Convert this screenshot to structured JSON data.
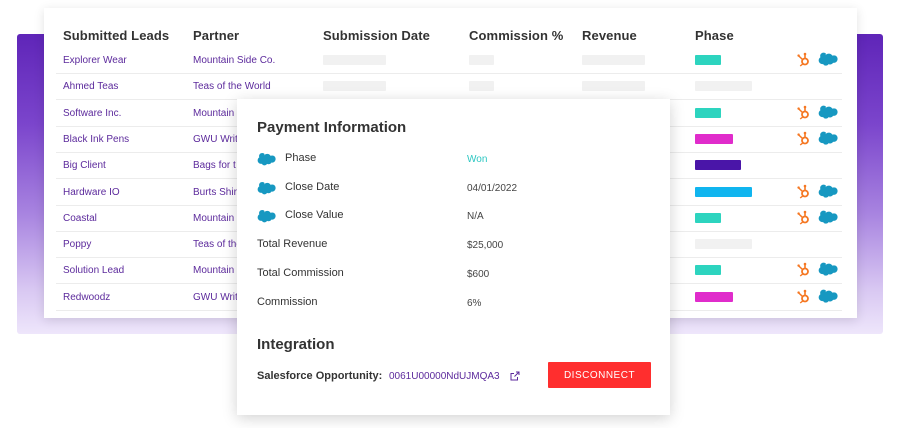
{
  "table": {
    "headers": {
      "lead": "Submitted Leads",
      "partner": "Partner",
      "submission_date": "Submission Date",
      "commission": "Commission %",
      "revenue": "Revenue",
      "phase": "Phase"
    },
    "rows": [
      {
        "lead": "Explorer Wear",
        "partner": "Mountain Side Co.",
        "phase_color": "#2dd4bf",
        "phase_level": 0.45,
        "hubspot": true,
        "salesforce": true
      },
      {
        "lead": "Ahmed Teas",
        "partner": "Teas of the World",
        "phase_color": "",
        "phase_level": 0,
        "hubspot": false,
        "salesforce": false
      },
      {
        "lead": "Software Inc.",
        "partner": "Mountain",
        "phase_color": "#2dd4bf",
        "phase_level": 0.45,
        "hubspot": true,
        "salesforce": true
      },
      {
        "lead": "Black Ink Pens",
        "partner": "GWU Writi",
        "phase_color": "#e02ccb",
        "phase_level": 0.67,
        "hubspot": true,
        "salesforce": true
      },
      {
        "lead": "Big Client",
        "partner": "Bags for t",
        "phase_color": "#4a15a8",
        "phase_level": 0.8,
        "hubspot": false,
        "salesforce": false
      },
      {
        "lead": "Hardware IO",
        "partner": "Burts Shir",
        "phase_color": "#10b5ef",
        "phase_level": 1.0,
        "hubspot": true,
        "salesforce": true
      },
      {
        "lead": "Coastal",
        "partner": "Mountain",
        "phase_color": "#2dd4bf",
        "phase_level": 0.45,
        "hubspot": true,
        "salesforce": true
      },
      {
        "lead": "Poppy",
        "partner": "Teas of the",
        "phase_color": "",
        "phase_level": 0,
        "hubspot": false,
        "salesforce": false
      },
      {
        "lead": "Solution Lead",
        "partner": "Mountain",
        "phase_color": "#2dd4bf",
        "phase_level": 0.45,
        "hubspot": true,
        "salesforce": true
      },
      {
        "lead": "Redwoodz",
        "partner": "GWU Writi",
        "phase_color": "#e02ccb",
        "phase_level": 0.67,
        "hubspot": true,
        "salesforce": true
      }
    ]
  },
  "payment": {
    "title": "Payment Information",
    "rows": [
      {
        "label": "Phase",
        "value": "Won",
        "icon": "salesforce-icon"
      },
      {
        "label": "Close Date",
        "value": "04/01/2022",
        "icon": "salesforce-icon"
      },
      {
        "label": "Close Value",
        "value": "N/A",
        "icon": "salesforce-icon"
      },
      {
        "label": "Total Revenue",
        "value": "$25,000",
        "icon": ""
      },
      {
        "label": "Total Commission",
        "value": "$600",
        "icon": ""
      },
      {
        "label": "Commission",
        "value": "6%",
        "icon": ""
      }
    ]
  },
  "integration": {
    "title": "Integration",
    "sf_label": "Salesforce Opportunity:",
    "sf_id": "0061U00000NdUJMQA3",
    "disconnect_label": "DISCONNECT"
  },
  "colors": {
    "accent_purple": "#5c2a9c",
    "won_teal": "#2cc7c2",
    "disconnect_red": "#ff2e2e",
    "hubspot_orange": "#f57722",
    "salesforce_blue": "#1798c1"
  }
}
